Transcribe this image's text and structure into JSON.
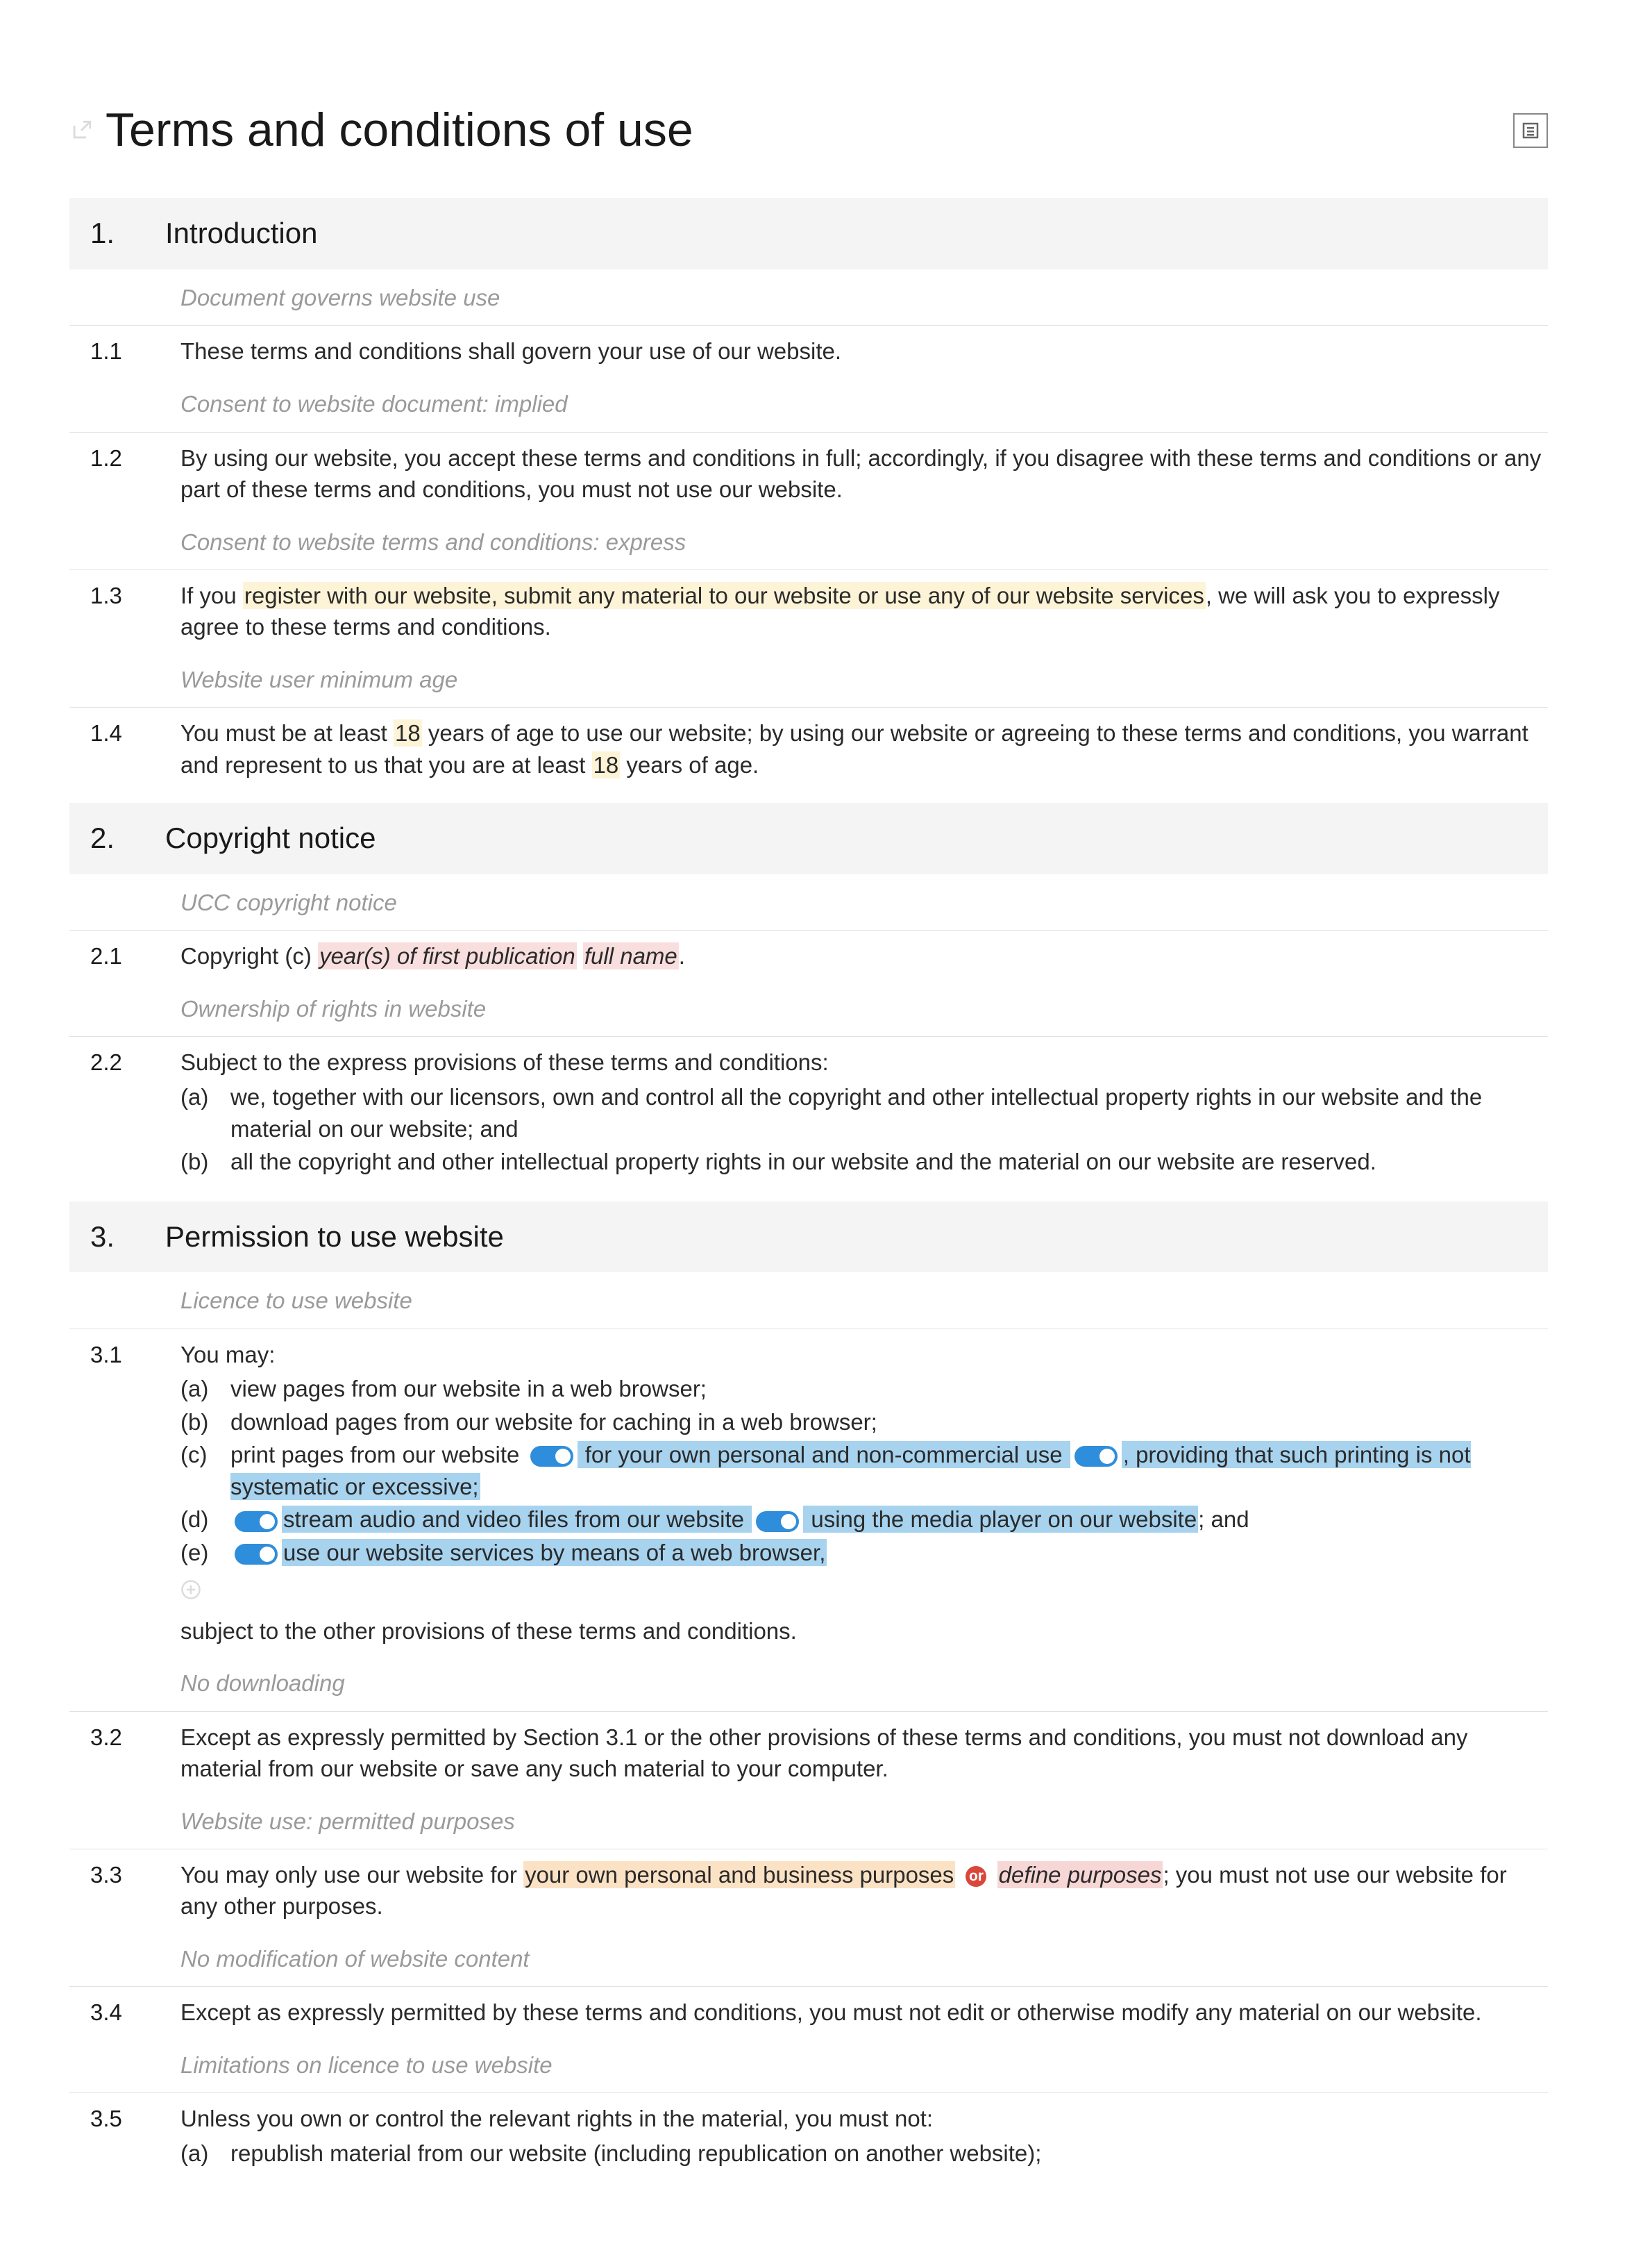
{
  "title": "Terms and conditions of use",
  "sections": [
    {
      "num": "1.",
      "title": "Introduction",
      "items": [
        {
          "type": "note",
          "text": "Document governs website use"
        },
        {
          "type": "clause",
          "num": "1.1",
          "runs": [
            {
              "t": "These terms and conditions shall govern your use of our website."
            }
          ]
        },
        {
          "type": "note",
          "text": "Consent to website document: implied"
        },
        {
          "type": "clause",
          "num": "1.2",
          "runs": [
            {
              "t": "By using our website, you accept these terms and conditions in full; accordingly, if you disagree with these terms and conditions or any part of these terms and conditions, you must not use our website."
            }
          ]
        },
        {
          "type": "note",
          "text": "Consent to website terms and conditions: express"
        },
        {
          "type": "clause",
          "num": "1.3",
          "runs": [
            {
              "t": "If you "
            },
            {
              "t": "register with our website, submit any material to our website or use any of our website services",
              "hl": "yellow"
            },
            {
              "t": ", we will ask you to expressly agree to these terms and conditions."
            }
          ]
        },
        {
          "type": "note",
          "text": "Website user minimum age"
        },
        {
          "type": "clause",
          "num": "1.4",
          "runs": [
            {
              "t": "You must be at least "
            },
            {
              "t": "18",
              "hl": "yellow"
            },
            {
              "t": " years of age to use our website; by using our website or agreeing to these terms and conditions, you warrant and represent to us that you are at least "
            },
            {
              "t": "18",
              "hl": "yellow"
            },
            {
              "t": " years of age."
            }
          ]
        }
      ]
    },
    {
      "num": "2.",
      "title": "Copyright notice",
      "items": [
        {
          "type": "note",
          "text": "UCC copyright notice"
        },
        {
          "type": "clause",
          "num": "2.1",
          "runs": [
            {
              "t": "Copyright (c) "
            },
            {
              "t": "year(s) of first publication",
              "hl": "pinkItalic"
            },
            {
              "t": " "
            },
            {
              "t": "full name",
              "hl": "pinkItalic"
            },
            {
              "t": "."
            }
          ]
        },
        {
          "type": "note",
          "text": "Ownership of rights in website"
        },
        {
          "type": "clause",
          "num": "2.2",
          "runs": [
            {
              "t": "Subject to the express provisions of these terms and conditions:"
            }
          ],
          "subs": [
            {
              "label": "(a)",
              "runs": [
                {
                  "t": "we, together with our licensors, own and control all the copyright and other intellectual property rights in our website and the material on our website; and"
                }
              ]
            },
            {
              "label": "(b)",
              "runs": [
                {
                  "t": "all the copyright and other intellectual property rights in our website and the material on our website are reserved."
                }
              ]
            }
          ]
        }
      ]
    },
    {
      "num": "3.",
      "title": "Permission to use website",
      "items": [
        {
          "type": "note",
          "text": "Licence to use website"
        },
        {
          "type": "clause",
          "num": "3.1",
          "runs": [
            {
              "t": "You may:"
            }
          ],
          "subs": [
            {
              "label": "(a)",
              "runs": [
                {
                  "t": "view pages from our website in a web browser;"
                }
              ]
            },
            {
              "label": "(b)",
              "runs": [
                {
                  "t": "download pages from our website for caching in a web browser;"
                }
              ]
            },
            {
              "label": "(c)",
              "runs": [
                {
                  "t": "print pages from our website "
                },
                {
                  "toggle": true
                },
                {
                  "t": " for your own personal and non-commercial use ",
                  "hl": "blue"
                },
                {
                  "toggle": true
                },
                {
                  "t": ", providing that such printing is not systematic or excessive;",
                  "hl": "blue"
                }
              ]
            },
            {
              "label": "(d)",
              "runs": [
                {
                  "toggle": true
                },
                {
                  "t": "stream audio and video files from our website ",
                  "hl": "blue"
                },
                {
                  "toggle": true
                },
                {
                  "t": " using the media player on our website",
                  "hl": "blue"
                },
                {
                  "t": "; and"
                }
              ]
            },
            {
              "label": "(e)",
              "runs": [
                {
                  "toggle": true
                },
                {
                  "t": "use our website services by means of a web browser,",
                  "hl": "blue"
                }
              ]
            }
          ],
          "plusIcon": true,
          "footer": [
            {
              "t": "subject to the other provisions of these terms and conditions."
            }
          ]
        },
        {
          "type": "note",
          "text": "No downloading"
        },
        {
          "type": "clause",
          "num": "3.2",
          "runs": [
            {
              "t": "Except as expressly permitted by Section 3.1 or the other provisions of these terms and conditions, you must not download any material from our website or save any such material to your computer."
            }
          ]
        },
        {
          "type": "note",
          "text": "Website use: permitted purposes"
        },
        {
          "type": "clause",
          "num": "3.3",
          "runs": [
            {
              "t": "You may only use our website for "
            },
            {
              "t": "your own personal and business purposes",
              "hl": "orange"
            },
            {
              "t": " "
            },
            {
              "orBadge": "or"
            },
            {
              "t": " "
            },
            {
              "t": "define purposes",
              "hl": "pink2"
            },
            {
              "t": "; you must not use our website for any other purposes."
            }
          ]
        },
        {
          "type": "note",
          "text": "No modification of website content"
        },
        {
          "type": "clause",
          "num": "3.4",
          "runs": [
            {
              "t": "Except as expressly permitted by these terms and conditions, you must not edit or otherwise modify any material on our website."
            }
          ]
        },
        {
          "type": "note",
          "text": "Limitations on licence to use website"
        },
        {
          "type": "clause",
          "num": "3.5",
          "runs": [
            {
              "t": "Unless you own or control the relevant rights in the material, you must not:"
            }
          ],
          "subs": [
            {
              "label": "(a)",
              "runs": [
                {
                  "t": "republish material from our website (including republication on another website);"
                }
              ]
            }
          ]
        }
      ]
    }
  ]
}
